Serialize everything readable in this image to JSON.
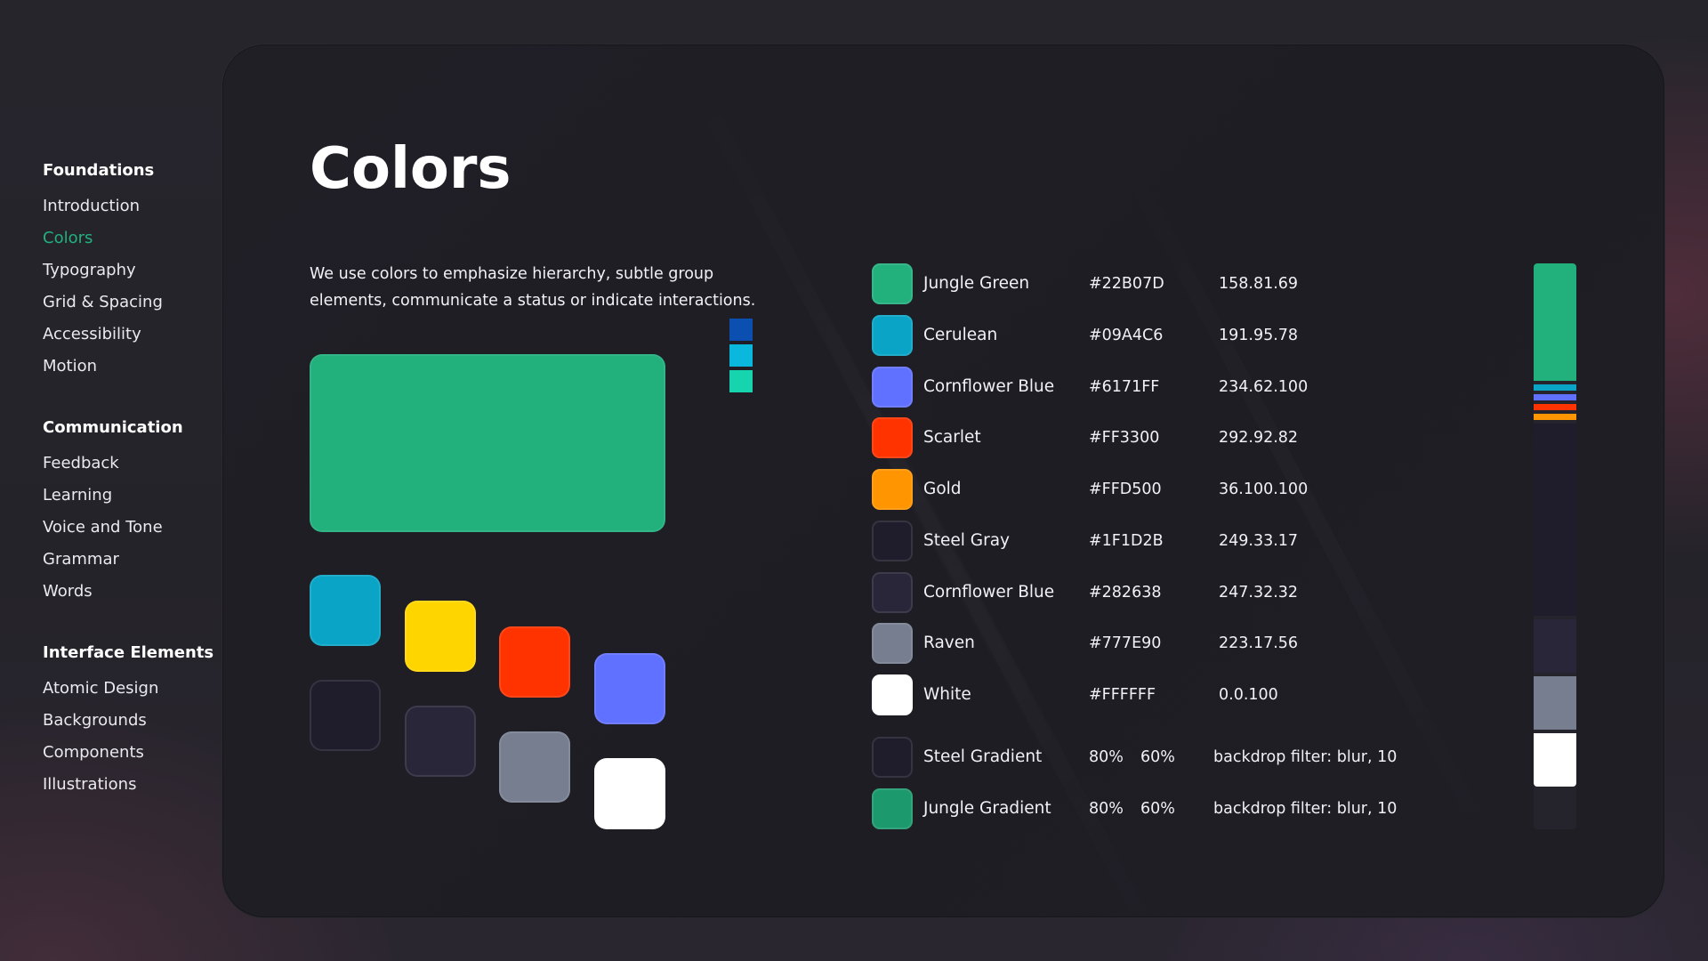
{
  "sidebar": {
    "groups": [
      {
        "heading": "Foundations",
        "items": [
          "Introduction",
          "Colors",
          "Typography",
          "Grid & Spacing",
          "Accessibility",
          "Motion"
        ]
      },
      {
        "heading": "Communication",
        "items": [
          "Feedback",
          "Learning",
          "Voice and Tone",
          "Grammar",
          "Words"
        ]
      },
      {
        "heading": "Interface Elements",
        "items": [
          "Atomic Design",
          "Backgrounds",
          "Components",
          "Illustrations"
        ]
      }
    ],
    "active_item": "Colors",
    "active_color": "#22B07D"
  },
  "page": {
    "title": "Colors",
    "description": "We use colors to emphasize hierarchy, subtle group elements, communicate a status or indicate interactions."
  },
  "swatches": {
    "hero": "#22B07D",
    "grid": [
      "#09A4C6",
      "#FFD500",
      "#FF3300",
      "#6171FF",
      "#1F1D2B",
      "#282638",
      "#777E90",
      "#FFFFFF"
    ],
    "mini": [
      "#0B4FB0",
      "#09B8DC",
      "#16D4AE"
    ]
  },
  "color_table": {
    "rows": [
      {
        "name": "Jungle Green",
        "hex": "#22B07D",
        "value": "158.81.69",
        "chip": "#22B07D"
      },
      {
        "name": "Cerulean",
        "hex": "#09A4C6",
        "value": "191.95.78",
        "chip": "#09A4C6"
      },
      {
        "name": "Cornflower Blue",
        "hex": "#6171FF",
        "value": "234.62.100",
        "chip": "#6171FF"
      },
      {
        "name": "Scarlet",
        "hex": "#FF3300",
        "value": "292.92.82",
        "chip": "#FF3300"
      },
      {
        "name": "Gold",
        "hex": "#FFD500",
        "value": "36.100.100",
        "chip": "#FF9500"
      },
      {
        "name": "Steel Gray",
        "hex": "#1F1D2B",
        "value": "249.33.17",
        "chip": "#1F1D2B"
      },
      {
        "name": "Cornflower Blue",
        "hex": "#282638",
        "value": "247.32.32",
        "chip": "#282638"
      },
      {
        "name": "Raven",
        "hex": "#777E90",
        "value": "223.17.56",
        "chip": "#777E90"
      },
      {
        "name": "White",
        "hex": "#FFFFFF",
        "value": "0.0.100",
        "chip": "#FFFFFF"
      }
    ],
    "gradient_rows": [
      {
        "name": "Steel Gradient",
        "stop1": "80%",
        "stop2": "60%",
        "effect": "backdrop filter: blur, 10",
        "chip": "#1F1D2B"
      },
      {
        "name": "Jungle Gradient",
        "stop1": "80%",
        "stop2": "60%",
        "effect": "backdrop filter: blur, 10",
        "chip": "#1C9A6E"
      }
    ]
  },
  "stack_bar": {
    "segments": [
      {
        "color": "#22B07D",
        "share": 0.218
      },
      {
        "color": "#09A4C6",
        "share": 0.011
      },
      {
        "color": "#6171FF",
        "share": 0.011
      },
      {
        "color": "#FF3300",
        "share": 0.011
      },
      {
        "color": "#FF9500",
        "share": 0.011
      },
      {
        "color": "#1F1D2B",
        "share": 0.358
      },
      {
        "color": "#282638",
        "share": 0.099
      },
      {
        "color": "#777E90",
        "share": 0.099
      },
      {
        "color": "#FFFFFF",
        "share": 0.099
      }
    ]
  }
}
